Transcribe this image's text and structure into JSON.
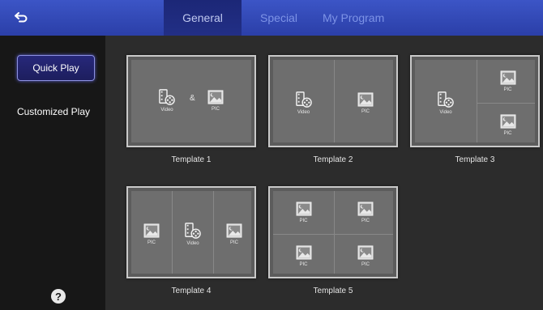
{
  "topbar": {
    "back_icon": "back-arrow-icon",
    "tabs": [
      {
        "label": "General",
        "active": true
      },
      {
        "label": "Special",
        "active": false
      },
      {
        "label": "My Program",
        "active": false
      }
    ]
  },
  "sidebar": {
    "items": [
      {
        "label": "Quick Play",
        "active": true
      },
      {
        "label": "Customized Play",
        "active": false
      }
    ],
    "help_label": "?"
  },
  "templates": [
    {
      "label": "Template 1",
      "captions": {
        "video": "Video",
        "amp": "&",
        "pic": "PIC"
      }
    },
    {
      "label": "Template 2",
      "captions": {
        "video": "Video",
        "pic": "PIC"
      }
    },
    {
      "label": "Template 3",
      "captions": {
        "video": "Video",
        "pic_top": "PIC",
        "pic_bottom": "PIC"
      }
    },
    {
      "label": "Template 4",
      "captions": {
        "pic_left": "PIC",
        "video": "Video",
        "pic_right": "PIC"
      }
    },
    {
      "label": "Template 5",
      "captions": {
        "pic_1": "PIC",
        "pic_2": "PIC",
        "pic_3": "PIC",
        "pic_4": "PIC"
      }
    }
  ],
  "colors": {
    "topbar": "#2f45b5",
    "active_tab": "#1f2a80",
    "inactive_tab_text": "#7d93e6",
    "sidebar": "#171717",
    "main": "#2c2c2c"
  }
}
